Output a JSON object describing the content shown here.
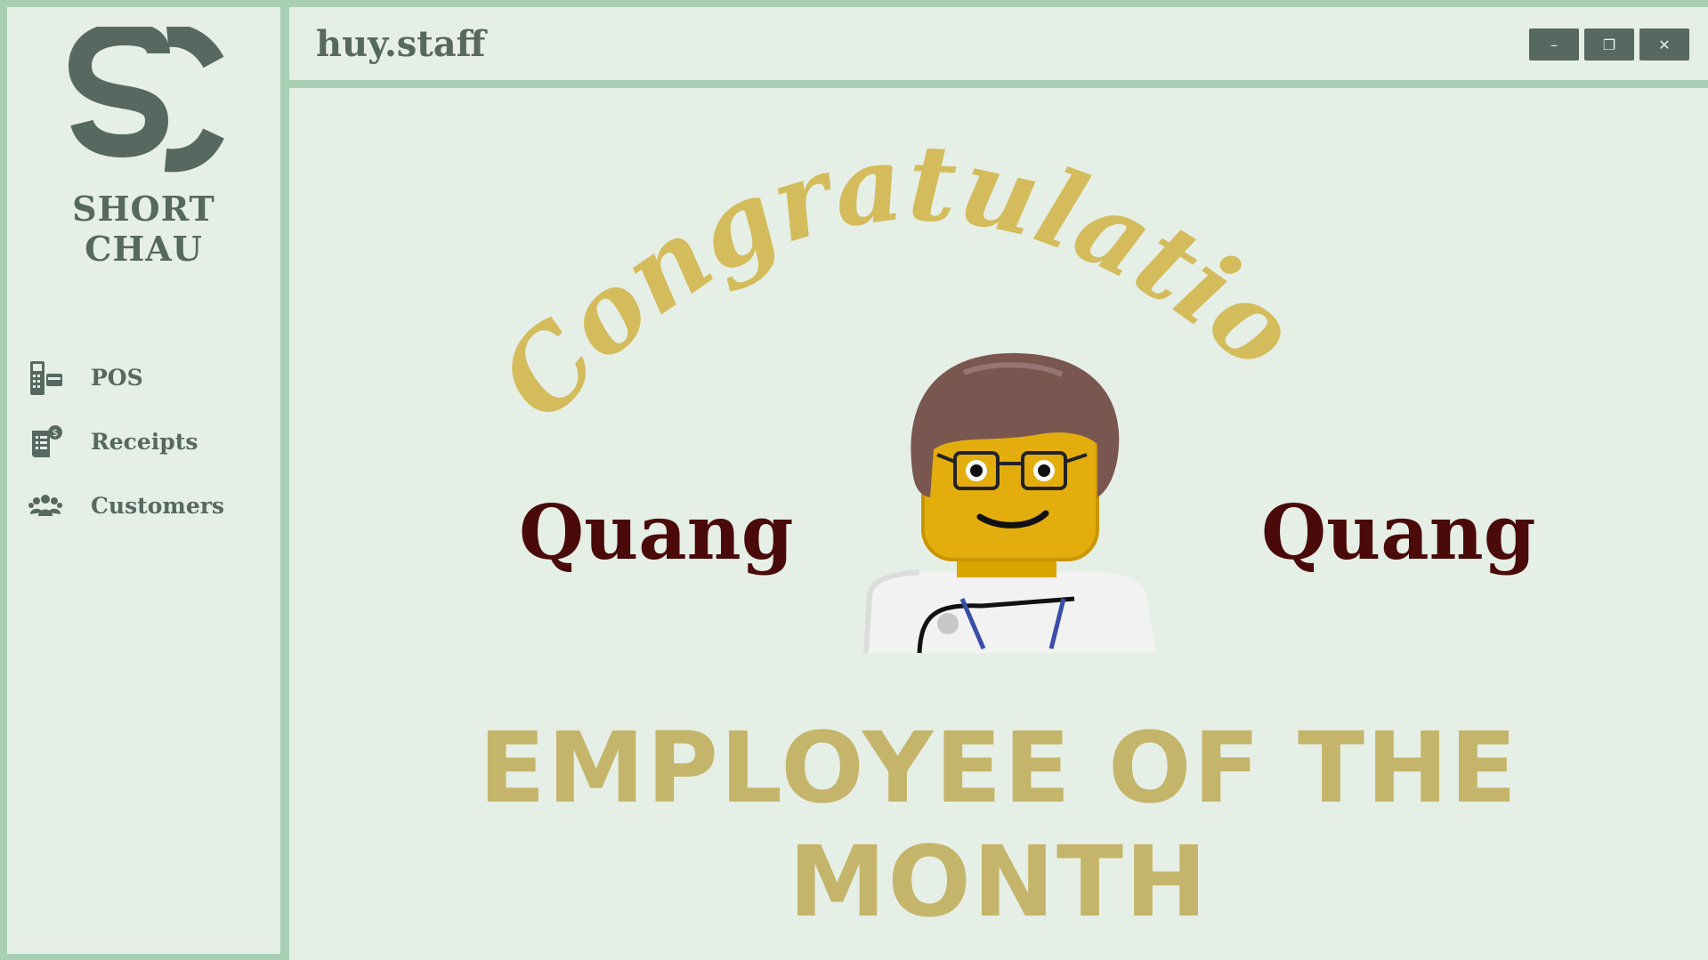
{
  "app": {
    "window_title": "huy.staff"
  },
  "brand": {
    "logo_letters": "SC",
    "name": "SHORT CHAU"
  },
  "sidebar": {
    "items": [
      {
        "label": "POS",
        "icon": "pos-terminal-icon"
      },
      {
        "label": "Receipts",
        "icon": "receipt-icon"
      },
      {
        "label": "Customers",
        "icon": "customers-icon"
      }
    ]
  },
  "window_controls": {
    "minimize": "–",
    "restore": "❐",
    "close": "✕"
  },
  "banner": {
    "congratulations": "Congratulations!",
    "name_left": "Quang",
    "name_right": "Quang",
    "headline": "EMPLOYEE OF THE MONTH"
  },
  "colors": {
    "accent": "#a8cfb4",
    "background": "#e5efe6",
    "text_dark": "#56685f",
    "gold": "#d4bc5c",
    "headline_gold": "#c4b56a",
    "name_color": "#4a0a0a"
  }
}
